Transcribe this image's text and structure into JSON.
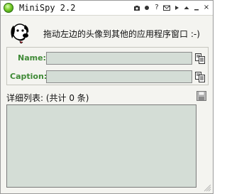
{
  "window": {
    "title": "MiniSpy 2.2",
    "buttons": [
      {
        "name": "screenshot",
        "icon": "camera-icon"
      },
      {
        "name": "record",
        "icon": "record-dot-icon"
      },
      {
        "name": "help",
        "icon": "help-icon",
        "glyph": "?"
      },
      {
        "name": "mail",
        "icon": "mail-icon"
      },
      {
        "name": "play",
        "icon": "play-icon"
      },
      {
        "name": "up",
        "icon": "up-arrow-icon"
      },
      {
        "name": "minimize",
        "icon": "minimize-icon"
      },
      {
        "name": "close",
        "icon": "close-icon",
        "glyph": "×"
      }
    ]
  },
  "header": {
    "hint": "拖动左边的头像到其他的应用程序窗口 :-)",
    "logo": "dog-head-icon"
  },
  "fields": {
    "name_label": "Name:",
    "name_value": "",
    "caption_label": "Caption:",
    "caption_value": ""
  },
  "list": {
    "label": "详细列表: (共计 0 条)",
    "items": []
  },
  "colors": {
    "label_green": "#3f8a36",
    "field_bg": "#d4ddd6",
    "window_bg": "#f4f4f0"
  }
}
